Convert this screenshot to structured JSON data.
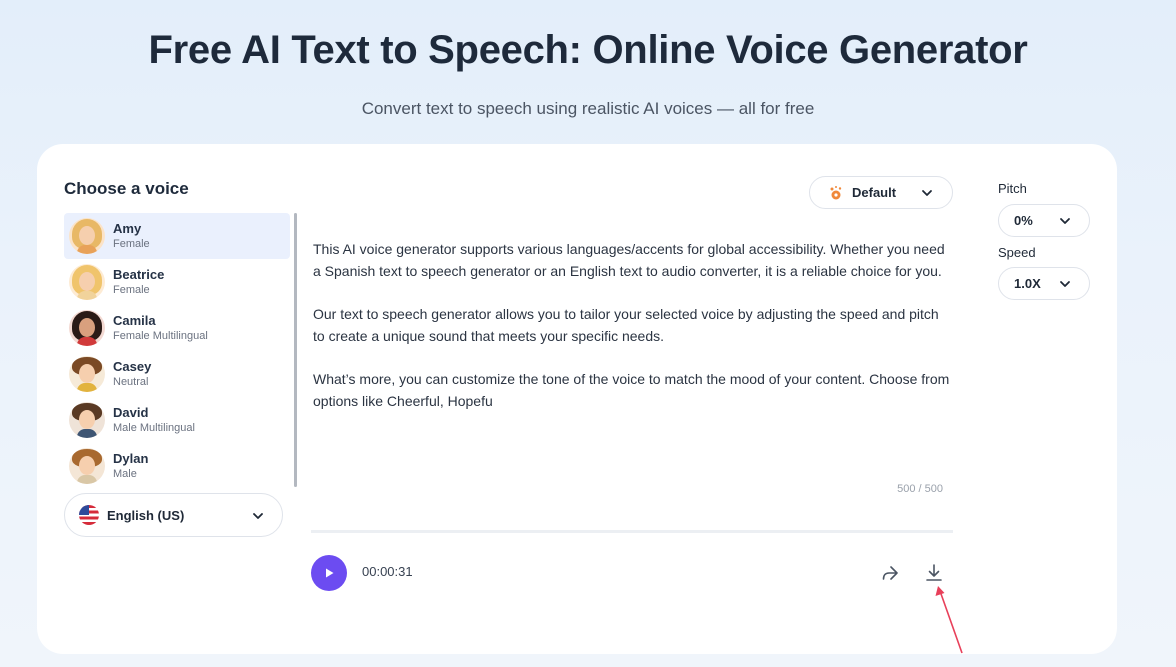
{
  "page": {
    "title": "Free AI Text to Speech: Online Voice Generator",
    "subtitle": "Convert text to speech using realistic AI voices — all for free"
  },
  "voices": {
    "heading": "Choose a voice",
    "items": [
      {
        "name": "Amy",
        "desc": "Female",
        "selected": true
      },
      {
        "name": "Beatrice",
        "desc": "Female"
      },
      {
        "name": "Camila",
        "desc": "Female Multilingual"
      },
      {
        "name": "Casey",
        "desc": "Neutral"
      },
      {
        "name": "David",
        "desc": "Male Multilingual"
      },
      {
        "name": "Dylan",
        "desc": "Male"
      }
    ],
    "language": "English (US)"
  },
  "style": {
    "label": "Default",
    "icon": "style-sparkle-icon"
  },
  "editor": {
    "paragraphs": [
      "This AI voice generator supports various languages/accents for global accessibility. Whether you need a Spanish text to speech generator or an English text to audio converter, it is a reliable choice for you.",
      "Our text to speech generator allows you to tailor your selected voice by adjusting the speed and pitch to create a unique sound that meets your specific needs.",
      "What’s more, you can customize the tone of the voice to match the mood of your content. Choose from options like Cheerful, Hopefu"
    ],
    "char_count": "500 / 500"
  },
  "player": {
    "time": "00:00:31",
    "progress": 0
  },
  "controls": {
    "pitch_label": "Pitch",
    "pitch_value": "0%",
    "speed_label": "Speed",
    "speed_value": "1.0X"
  },
  "colors": {
    "accent": "#6c4cf1",
    "annotation": "#e8405a"
  }
}
